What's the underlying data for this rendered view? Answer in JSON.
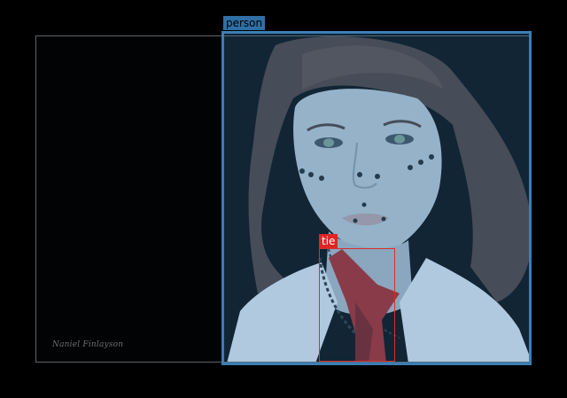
{
  "image": {
    "subject": "stylized female avatar portrait with facial piercings, white collared shirt and red tie",
    "signature": "Naniel Finlayson"
  },
  "detections": [
    {
      "label": "person",
      "color": "#3b7fb6"
    },
    {
      "label": "tie",
      "color": "#e02525"
    }
  ],
  "colors": {
    "background": "#000000",
    "person_box": "#3b7fb6",
    "tie_box": "#d92e2e"
  }
}
